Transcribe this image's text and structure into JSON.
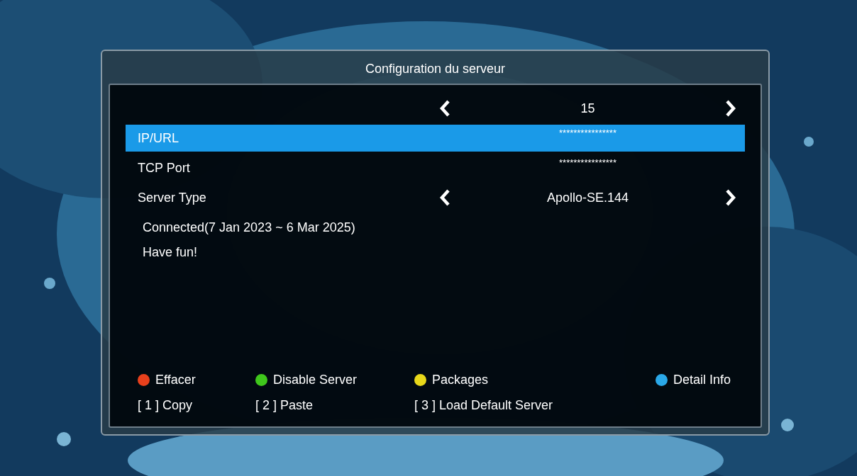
{
  "dialog": {
    "title": "Configuration du serveur"
  },
  "rows": [
    {
      "kind": "selector",
      "value": "15",
      "selected": false
    },
    {
      "kind": "field",
      "label": "IP/URL",
      "value": "****************",
      "selected": true
    },
    {
      "kind": "field",
      "label": "TCP Port",
      "value": "****************",
      "selected": false
    },
    {
      "kind": "selector",
      "label": "Server Type",
      "value": "Apollo-SE.144",
      "selected": false
    }
  ],
  "status_lines": [
    "Connected(7 Jan 2023 ~ 6 Mar 2025)",
    "Have fun!"
  ],
  "color_keys": [
    {
      "label": "Effacer",
      "color": "#e8401c"
    },
    {
      "label": "Disable Server",
      "color": "#3fc71c"
    },
    {
      "label": "Packages",
      "color": "#e8d81a"
    },
    {
      "label": "Detail Info",
      "color": "#2aa8e8"
    }
  ],
  "number_keys": [
    {
      "key": "[ 1 ]",
      "label": "Copy"
    },
    {
      "key": "[ 2 ]",
      "label": "Paste"
    },
    {
      "key": "[ 3 ]",
      "label": "Load Default Server"
    }
  ]
}
